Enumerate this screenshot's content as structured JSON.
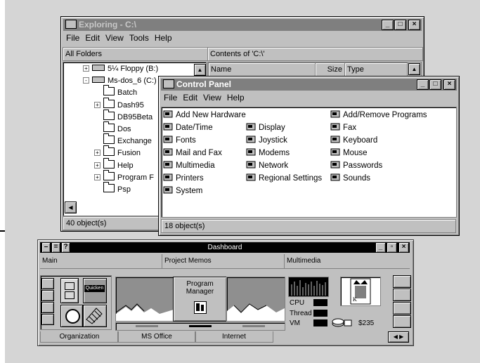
{
  "explorer": {
    "title": "Exploring - C:\\",
    "menu": [
      "File",
      "Edit",
      "View",
      "Tools",
      "Help"
    ],
    "folders_header": "All Folders",
    "contents_header": "Contents of 'C:\\'",
    "columns": [
      "Name",
      "Size",
      "Type"
    ],
    "tree": [
      {
        "label": "5¼ Floppy (B:)",
        "kind": "drive",
        "expander": "+"
      },
      {
        "label": "Ms-dos_6 (C:)",
        "kind": "drive",
        "expander": "-"
      },
      {
        "label": "Batch",
        "kind": "folder",
        "expander": ""
      },
      {
        "label": "Dash95",
        "kind": "folder",
        "expander": "+"
      },
      {
        "label": "DB95Beta",
        "kind": "folder",
        "expander": ""
      },
      {
        "label": "Dos",
        "kind": "folder",
        "expander": ""
      },
      {
        "label": "Exchange",
        "kind": "folder",
        "expander": ""
      },
      {
        "label": "Fusion",
        "kind": "folder",
        "expander": "+"
      },
      {
        "label": "Help",
        "kind": "folder",
        "expander": "+"
      },
      {
        "label": "Program F",
        "kind": "folder",
        "expander": "+"
      },
      {
        "label": "Psp",
        "kind": "folder",
        "expander": ""
      }
    ],
    "status": "40 object(s)"
  },
  "control_panel": {
    "title": "Control Panel",
    "menu": [
      "File",
      "Edit",
      "View",
      "Help"
    ],
    "items": [
      {
        "label": "Add New Hardware",
        "icon": "hardware-icon"
      },
      {
        "label": "Add/Remove Programs",
        "icon": "add-remove-programs-icon"
      },
      {
        "label": "Date/Time",
        "icon": "calendar-icon"
      },
      {
        "label": "Display",
        "icon": "display-icon"
      },
      {
        "label": "Fax",
        "icon": "fax-icon"
      },
      {
        "label": "Fonts",
        "icon": "fonts-icon"
      },
      {
        "label": "Joystick",
        "icon": "joystick-icon"
      },
      {
        "label": "Keyboard",
        "icon": "keyboard-icon"
      },
      {
        "label": "Mail and Fax",
        "icon": "mail-icon"
      },
      {
        "label": "Modems",
        "icon": "modem-icon"
      },
      {
        "label": "Mouse",
        "icon": "mouse-icon"
      },
      {
        "label": "Multimedia",
        "icon": "multimedia-icon"
      },
      {
        "label": "Network",
        "icon": "network-icon"
      },
      {
        "label": "Passwords",
        "icon": "keys-icon"
      },
      {
        "label": "Printers",
        "icon": "printer-icon"
      },
      {
        "label": "Regional Settings",
        "icon": "globe-icon"
      },
      {
        "label": "Sounds",
        "icon": "speaker-icon"
      },
      {
        "label": "System",
        "icon": "computer-icon"
      }
    ],
    "status": "18 object(s)"
  },
  "dashboard": {
    "title": "Dashboard",
    "help_glyph": "?",
    "top_tabs": [
      "Main",
      "Project Memos",
      "Multimedia"
    ],
    "bottom_tabs": [
      "Organization",
      "MS Office",
      "Internet"
    ],
    "program_manager_label": "Program\nManager",
    "quicken_label": "Quicken",
    "meters": {
      "cpu_label": "CPU",
      "thread_label": "Thread",
      "vm_label": "VM"
    },
    "money": "$235"
  },
  "colors": {
    "desktop": "#d5d5d5",
    "window": "#c0c0c0",
    "active_title": "#000000",
    "inactive_title": "#7f7f7f"
  }
}
